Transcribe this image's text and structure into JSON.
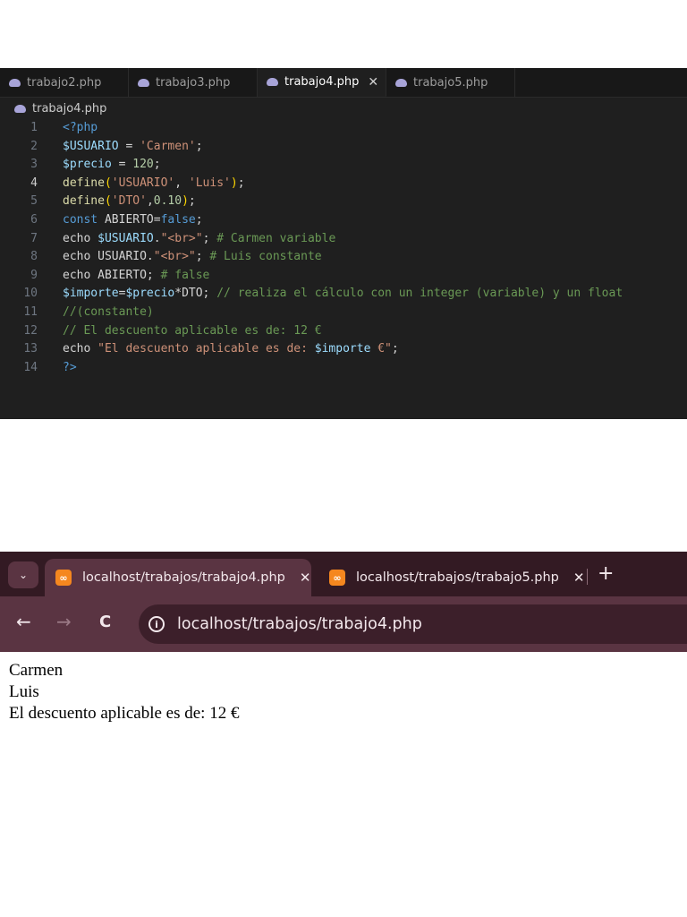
{
  "editor": {
    "tabs": [
      {
        "label": "trabajo2.php",
        "active": false
      },
      {
        "label": "trabajo3.php",
        "active": false
      },
      {
        "label": "trabajo4.php",
        "active": true
      },
      {
        "label": "trabajo5.php",
        "active": false
      }
    ],
    "close_glyph": "✕",
    "breadcrumb": "trabajo4.php",
    "line_numbers": [
      "1",
      "2",
      "3",
      "4",
      "5",
      "6",
      "7",
      "8",
      "9",
      "10",
      "11",
      "12",
      "13",
      "14"
    ],
    "current_line": "4",
    "code": {
      "l1": "<?php",
      "l2_var": "$USUARIO",
      "l2_eq": " = ",
      "l2_str": "'Carmen'",
      "l2_end": ";",
      "l3_var": "$precio",
      "l3_eq": " = ",
      "l3_num": "120",
      "l3_end": ";",
      "l4_fn": "define",
      "l4_open": "(",
      "l4_str1": "'USUARIO'",
      "l4_comma": ", ",
      "l4_str2": "'Luis'",
      "l4_close": ")",
      "l4_end": ";",
      "l5_fn": "define",
      "l5_open": "(",
      "l5_str": "'DTO'",
      "l5_comma": ",",
      "l5_num": "0.10",
      "l5_close": ")",
      "l5_end": ";",
      "l6_kw": "const",
      "l6_name": " ABIERTO=",
      "l6_bool": "false",
      "l6_end": ";",
      "l7_kw": "echo ",
      "l7_var": "$USUARIO",
      "l7_dot": ".",
      "l7_str": "\"<br>\"",
      "l7_end": "; ",
      "l7_cm": "# Carmen variable",
      "l8_kw": "echo ",
      "l8_name": "USUARIO.",
      "l8_str": "\"<br>\"",
      "l8_end": "; ",
      "l8_cm": "# Luis constante",
      "l9_kw": "echo ",
      "l9_name": "ABIERTO; ",
      "l9_cm": "# false",
      "l10_var1": "$importe",
      "l10_eq": "=",
      "l10_var2": "$precio",
      "l10_op": "*DTO; ",
      "l10_cm": "// realiza el cálculo con un integer (variable) y un float",
      "l11_cm": "//(constante)",
      "l12_cm": "// El descuento aplicable es de: 12 €",
      "l13_kw": "echo ",
      "l13_str1": "\"El descuento aplicable es de: ",
      "l13_var": "$importe",
      "l13_str2": " €\"",
      "l13_end": ";",
      "l14": "?>"
    }
  },
  "browser": {
    "tab_search_glyph": "⌄",
    "tabs": [
      {
        "title": "localhost/trabajos/trabajo4.php",
        "active": true
      },
      {
        "title": "localhost/trabajos/trabajo5.php",
        "active": false
      }
    ],
    "tab_close_glyph": "✕",
    "new_tab_glyph": "+",
    "back_glyph": "←",
    "forward_glyph": "→",
    "reload_glyph": "C",
    "info_glyph": "i",
    "url": "localhost/trabajos/trabajo4.php"
  },
  "output": {
    "lines": [
      "Carmen",
      "Luis",
      "El descuento aplicable es de: 12 €"
    ]
  },
  "colors": {
    "editor_bg": "#1f1f1f",
    "browser_frame": "#3c1f2a",
    "browser_toolbar": "#5a3442",
    "xampp_orange": "#f5871f"
  }
}
